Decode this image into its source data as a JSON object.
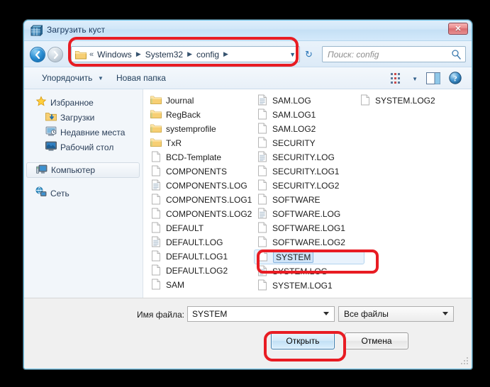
{
  "window": {
    "title": "Загрузить куст",
    "icon": "registry-hive-icon",
    "close_label": "✕"
  },
  "address_bar": {
    "back_icon": "arrow-left-icon",
    "forward_icon": "arrow-right-icon",
    "folder_icon": "folder-icon",
    "overflow": "«",
    "crumbs": [
      "Windows",
      "System32",
      "config"
    ],
    "separator": "▶",
    "dropdown_icon": "▼",
    "refresh_icon": "↻",
    "search_placeholder": "Поиск: config",
    "search_icon": "search-icon"
  },
  "toolbar": {
    "organize_label": "Упорядочить",
    "organize_caret": "▼",
    "new_folder_label": "Новая папка",
    "views_icon": "views-icon",
    "views_caret": "▼",
    "preview_icon": "preview-pane-icon",
    "help_icon": "help-icon"
  },
  "sidebar": {
    "items": [
      {
        "label": "Избранное",
        "icon": "star-icon",
        "level": 0,
        "selected": false
      },
      {
        "label": "Загрузки",
        "icon": "downloads-icon",
        "level": 1,
        "selected": false
      },
      {
        "label": "Недавние места",
        "icon": "recent-places-icon",
        "level": 1,
        "selected": false
      },
      {
        "label": "Рабочий стол",
        "icon": "desktop-icon",
        "level": 1,
        "selected": false
      },
      {
        "label": "Компьютер",
        "icon": "computer-icon",
        "level": 0,
        "selected": true
      },
      {
        "label": "Сеть",
        "icon": "network-icon",
        "level": 0,
        "selected": false
      }
    ]
  },
  "file_list": {
    "columns": [
      [
        {
          "name": "Journal",
          "type": "folder"
        },
        {
          "name": "RegBack",
          "type": "folder"
        },
        {
          "name": "systemprofile",
          "type": "folder"
        },
        {
          "name": "TxR",
          "type": "folder"
        },
        {
          "name": "BCD-Template",
          "type": "file"
        },
        {
          "name": "COMPONENTS",
          "type": "file"
        },
        {
          "name": "COMPONENTS.LOG",
          "type": "log"
        },
        {
          "name": "COMPONENTS.LOG1",
          "type": "file"
        },
        {
          "name": "COMPONENTS.LOG2",
          "type": "file"
        },
        {
          "name": "DEFAULT",
          "type": "file"
        },
        {
          "name": "DEFAULT.LOG",
          "type": "log"
        },
        {
          "name": "DEFAULT.LOG1",
          "type": "file"
        },
        {
          "name": "DEFAULT.LOG2",
          "type": "file"
        },
        {
          "name": "SAM",
          "type": "file"
        }
      ],
      [
        {
          "name": "SAM.LOG",
          "type": "log"
        },
        {
          "name": "SAM.LOG1",
          "type": "file"
        },
        {
          "name": "SAM.LOG2",
          "type": "file"
        },
        {
          "name": "SECURITY",
          "type": "file"
        },
        {
          "name": "SECURITY.LOG",
          "type": "log"
        },
        {
          "name": "SECURITY.LOG1",
          "type": "file"
        },
        {
          "name": "SECURITY.LOG2",
          "type": "file"
        },
        {
          "name": "SOFTWARE",
          "type": "file"
        },
        {
          "name": "SOFTWARE.LOG",
          "type": "log"
        },
        {
          "name": "SOFTWARE.LOG1",
          "type": "file"
        },
        {
          "name": "SOFTWARE.LOG2",
          "type": "file"
        },
        {
          "name": "SYSTEM",
          "type": "file",
          "selected": true
        },
        {
          "name": "SYSTEM.LOG",
          "type": "log"
        },
        {
          "name": "SYSTEM.LOG1",
          "type": "file"
        }
      ],
      [
        {
          "name": "SYSTEM.LOG2",
          "type": "file"
        }
      ]
    ]
  },
  "footer": {
    "filename_label": "Имя файла:",
    "filename_value": "SYSTEM",
    "filetype_value": "Все файлы",
    "open_label": "Открыть",
    "cancel_label": "Отмена"
  },
  "annotations": {
    "color": "#e81c23",
    "boxes": [
      "address-bar",
      "system-file-row",
      "open-button"
    ]
  }
}
